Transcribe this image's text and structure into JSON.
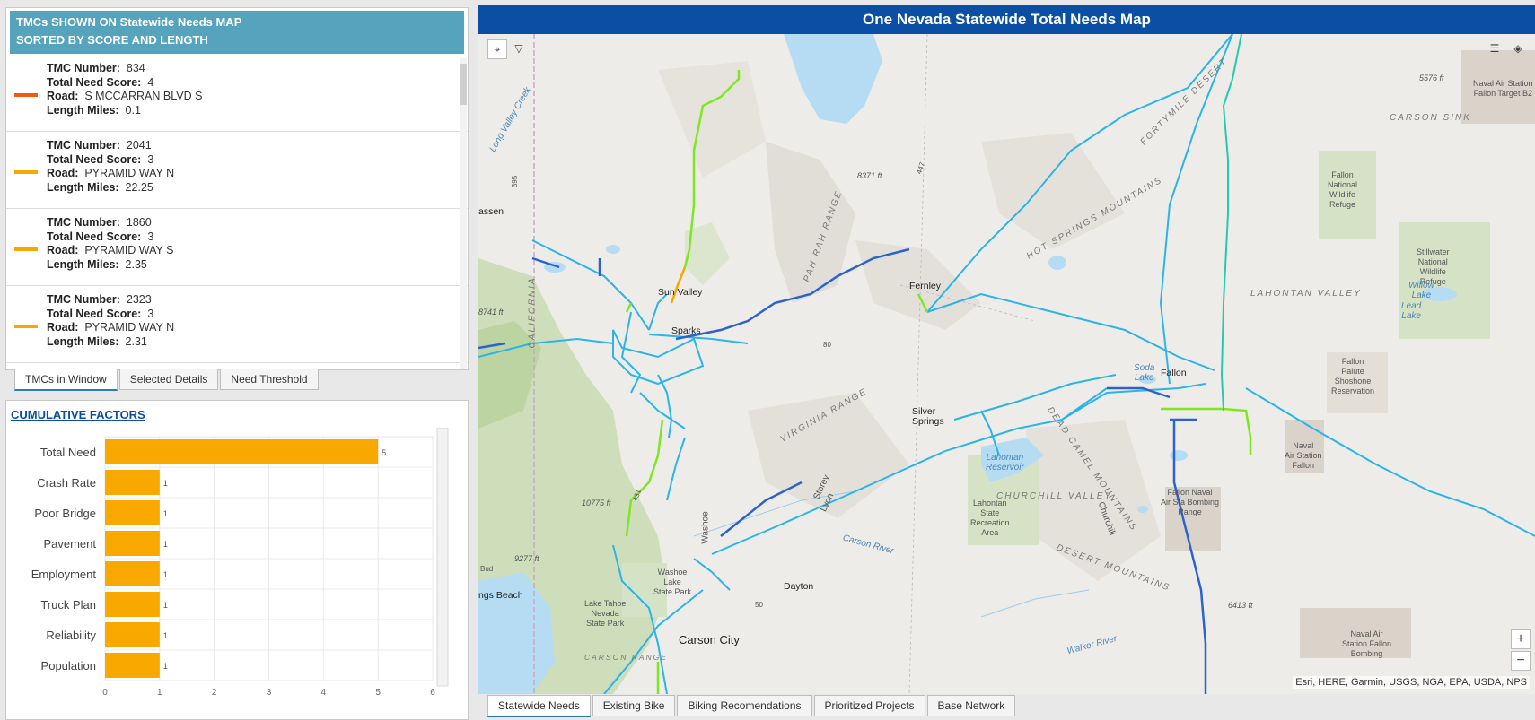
{
  "list_panel": {
    "header_line1": "TMCs SHOWN ON Statewide Needs MAP",
    "header_line2": "SORTED BY SCORE AND LENGTH",
    "field_labels": {
      "tmc": "TMC Number:",
      "score": "Total Need Score:",
      "road": "Road:",
      "length": "Length Miles:"
    },
    "items": [
      {
        "tmc": "834",
        "score": "4",
        "road": "S MCCARRAN BLVD S",
        "length": "0.1",
        "color": "#f25a12"
      },
      {
        "tmc": "2041",
        "score": "3",
        "road": "PYRAMID WAY N",
        "length": "22.25",
        "color": "#f5a800"
      },
      {
        "tmc": "1860",
        "score": "3",
        "road": "PYRAMID WAY S",
        "length": "2.35",
        "color": "#f5a800"
      },
      {
        "tmc": "2323",
        "score": "3",
        "road": "PYRAMID WAY N",
        "length": "2.31",
        "color": "#f5a800"
      }
    ]
  },
  "list_tabs": [
    "TMCs in Window",
    "Selected Details",
    "Need Threshold"
  ],
  "chart_panel": {
    "title": "CUMULATIVE FACTORS"
  },
  "chart_data": {
    "type": "bar",
    "orientation": "horizontal",
    "categories": [
      "Total Need",
      "Crash Rate",
      "Poor Bridge",
      "Pavement",
      "Employment",
      "Truck Plan",
      "Reliability",
      "Population"
    ],
    "values": [
      5,
      1,
      1,
      1,
      1,
      1,
      1,
      1
    ],
    "xlim": [
      0,
      6
    ],
    "xticks": [
      "0",
      "1",
      "2",
      "3",
      "4",
      "5",
      "6"
    ],
    "bar_color": "#f9a800",
    "grid": true
  },
  "map": {
    "title": "One Nevada Statewide Total Needs Map",
    "attribution": "Esri, HERE, Garmin, USGS, NGA, EPA, USDA, NPS",
    "zoom_in": "+",
    "zoom_out": "−",
    "labels": {
      "sun_valley": "Sun Valley",
      "sparks": "Sparks",
      "fernley": "Fernley",
      "fallon": "Fallon",
      "silver_springs": "Silver\nSprings",
      "dayton": "Dayton",
      "carson_city": "Carson City",
      "carson_sink": "CARSON SINK",
      "lahontan_valley": "LAHONTAN VALLEY",
      "churchill_valley": "CHURCHILL VALLEY",
      "virginia_range": "VIRGINIA RANGE",
      "hot_springs_mtns": "HOT SPRINGS MOUNTAINS",
      "fortymile_desert": "FORTYMILE DESERT",
      "dead_camel_mtns": "DEAD CAMEL MOUNTAINS",
      "desert_mtns": "DESERT MOUNTAINS",
      "pah_rah_range": "PAH RAH RANGE",
      "carson_range": "CARSON RANGE",
      "california": "CALIFORNIA",
      "washoe": "Washoe",
      "fallon_nwr": "Fallon\nNational\nWildlife\nRefuge",
      "stillwater_nwr": "Stillwater\nNational\nWildlife\nRefuge",
      "fallon_reservation": "Fallon\nPaiute\nShoshone\nReservation",
      "naval_air_station_fallon": "Naval\nAir Station\nFallon",
      "fallon_naval_range": "Fallon Naval\nAir Sta Bombing\nRange",
      "naval_air_station_bombing": "Naval Air\nStation Fallon\nBombing",
      "naval_air_target": "Naval Air Station\nFallon Target B2",
      "lahontan_reservoir": "Lahontan\nReservoir",
      "lahontan_recreation": "Lahontan\nState\nRecreation\nArea",
      "washoe_lake": "Washoe\nLake\nState Park",
      "lake_tahoe_park": "Lake Tahoe\nNevada\nState Park",
      "willow_lake": "Willow\nLake",
      "lead_lake": "Lead\nLake",
      "soda_lake": "Soda\nLake",
      "carson_river": "Carson River",
      "walker_river": "Walker River",
      "long_valley_creek": "Long Valley Creek",
      "assen": "assen",
      "ngs_beach": "ngs Beach",
      "churchill": "Churchill",
      "storey": "Storey",
      "lyon": "Lyon",
      "elev_8741": "8741 ft",
      "elev_8371": "8371 ft",
      "elev_10775": "10775 ft",
      "elev_9277": "9277 ft",
      "elev_5576": "5576 ft",
      "elev_6413": "6413 ft",
      "hwy_395": "395",
      "hwy_447": "447",
      "hwy_431": "431",
      "hwy_50": "50",
      "hwy_80": "80",
      "rte_bud": "Bud"
    }
  },
  "map_tabs": [
    "Statewide Needs",
    "Existing Bike",
    "Biking Recomendations",
    "Prioritized Projects",
    "Base Network"
  ],
  "colors": {
    "title_bar": "#0a4fa3",
    "list_header": "#56a3bd",
    "road_light_blue": "#2bb4e8",
    "road_dark_blue": "#2c62d0",
    "road_green": "#7de81f",
    "road_orange": "#f5a800",
    "water": "#b5dcf3"
  }
}
